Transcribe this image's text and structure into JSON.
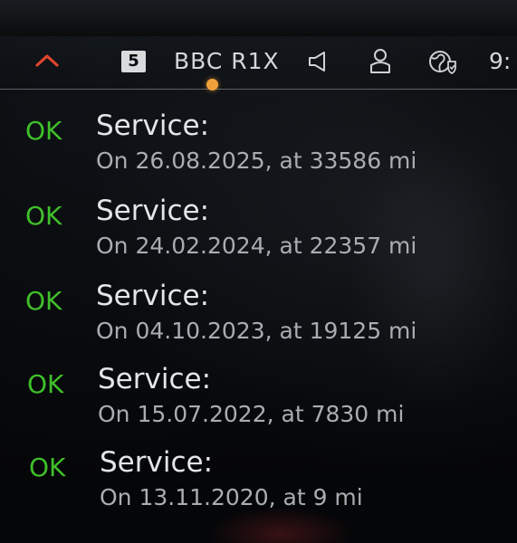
{
  "status_bar": {
    "preset_number": "5",
    "station_name": "BBC R1X",
    "clock": "9:",
    "icons": {
      "collapse": "chevron-up-icon",
      "speaker": "speaker-icon",
      "profile": "user-profile-icon",
      "connectivity": "globe-shield-icon"
    },
    "colors": {
      "collapse_chevron": "#e0452e",
      "focus_indicator": "#f0a03a"
    }
  },
  "service_history": {
    "status_color": "#3fbf2a",
    "entries": [
      {
        "status": "OK",
        "title": "Service:",
        "detail": "On 26.08.2025, at 33586 mi"
      },
      {
        "status": "OK",
        "title": "Service:",
        "detail": "On 24.02.2024, at 22357 mi"
      },
      {
        "status": "OK",
        "title": "Service:",
        "detail": "On 04.10.2023, at 19125 mi"
      },
      {
        "status": "OK",
        "title": "Service:",
        "detail": "On 15.07.2022, at 7830 mi"
      },
      {
        "status": "OK",
        "title": "Service:",
        "detail": "On 13.11.2020, at 9 mi"
      }
    ]
  }
}
